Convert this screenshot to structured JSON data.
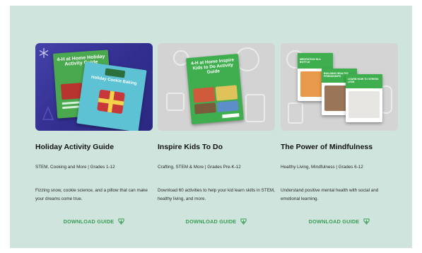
{
  "cards": [
    {
      "title": "Holiday Activity Guide",
      "meta": "STEM, Cooking and More | Grades 1-12",
      "desc": "Fizzing snow, cookie science, and a pillow that can make your dreams come true.",
      "cta": "DOWNLOAD GUIDE",
      "cover_text": "4-H at Home Holiday Activity Guide",
      "cover_text2": "Holiday Cookie Baking"
    },
    {
      "title": "Inspire Kids To Do",
      "meta": "Crafting, STEM & More | Grades Pre-K-12",
      "desc": "Download 60 activities to help your kid learn skills in STEM, healthy living, and more.",
      "cta": "DOWNLOAD GUIDE",
      "cover_text": "4-H at Home Inspire Kids to Do Activity Guide"
    },
    {
      "title": "The Power of Mindfulness",
      "meta": "Healthy Living, Mindfulness | Grades 6-12",
      "desc": "Understand positive mental health with social and emotional learning.",
      "cta": "DOWNLOAD GUIDE",
      "cover_text": "MEDITATION IN A BOTTLE",
      "cover_text2": "BUILDING HEALTHY FRIENDSHIPS",
      "cover_text3": "LEARN HOW TO STRESS LESS"
    }
  ],
  "colors": {
    "panel": "#cfe4dc",
    "accent": "#3a9d55",
    "card1_bg": "#3a37a0",
    "cover_green": "#3fae4e"
  },
  "icons": {
    "download": "download-arrow-icon"
  }
}
